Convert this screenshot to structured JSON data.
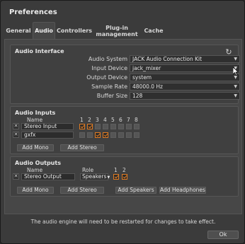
{
  "window": {
    "title": "Preferences"
  },
  "tabs": [
    {
      "label": "General",
      "active": false
    },
    {
      "label": "Audio",
      "active": true
    },
    {
      "label": "Controllers",
      "active": false
    },
    {
      "label": "Plug-in management",
      "active": false
    },
    {
      "label": "Cache",
      "active": false
    }
  ],
  "audio_interface": {
    "title": "Audio Interface",
    "fields": [
      {
        "label": "Audio System",
        "value": "JACK Audio Connection Kit"
      },
      {
        "label": "Input Device",
        "value": "jack_mixer"
      },
      {
        "label": "Output Device",
        "value": "system"
      },
      {
        "label": "Sample Rate",
        "value": "48000.0 Hz"
      },
      {
        "label": "Buffer Size",
        "value": "128"
      }
    ]
  },
  "audio_inputs": {
    "title": "Audio Inputs",
    "name_header": "Name",
    "channel_numbers": [
      "1",
      "2",
      "3",
      "4",
      "5",
      "6",
      "7",
      "8"
    ],
    "rows": [
      {
        "name": "Stereo Input",
        "channels": [
          true,
          true,
          false,
          false,
          false,
          false,
          false,
          false
        ]
      },
      {
        "name": "gxfx",
        "channels": [
          false,
          false,
          true,
          true,
          false,
          false,
          false,
          false
        ]
      }
    ],
    "buttons": {
      "add_mono": "Add Mono",
      "add_stereo": "Add Stereo"
    }
  },
  "audio_outputs": {
    "title": "Audio Outputs",
    "name_header": "Name",
    "role_header": "Role",
    "channel_numbers": [
      "1",
      "2"
    ],
    "rows": [
      {
        "name": "Stereo Output",
        "role": "Speakers",
        "channels": [
          true,
          true
        ]
      }
    ],
    "buttons": {
      "add_mono": "Add Mono",
      "add_stereo": "Add Stereo",
      "add_speakers": "Add Speakers",
      "add_headphones": "Add Headphones"
    }
  },
  "footer": {
    "message": "The audio engine will need to be restarted for changes to take effect.",
    "ok_label": "Ok"
  },
  "icons": {
    "refresh": "refresh-icon",
    "remove": "close-icon",
    "dropdown": "chevron-down-icon"
  },
  "colors": {
    "accent": "#e07b22",
    "background": "#3b3b3b",
    "panel": "#474747"
  }
}
